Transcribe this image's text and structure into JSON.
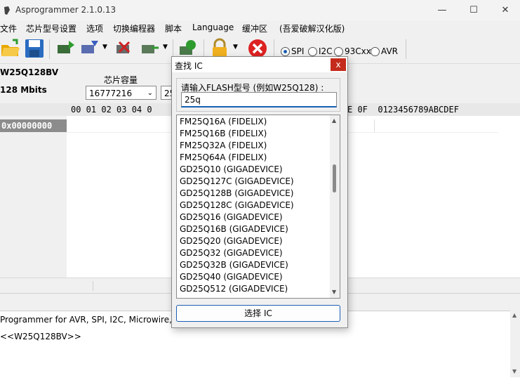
{
  "window": {
    "title": "Asprogrammer 2.1.0.13",
    "controls": [
      "—",
      "☐",
      "✕"
    ]
  },
  "menu": [
    "文件",
    "芯片型号设置",
    "选项",
    "切换编程器",
    "脚本",
    "Language",
    "缓冲区",
    "(吾爱破解汉化版)"
  ],
  "toolbar": {
    "icons": [
      "open-folder-icon",
      "save-icon",
      "read-chip-icon",
      "write-chip-icon",
      "erase-chip-icon",
      "verify-chip-icon",
      "blank-check-icon",
      "lock-icon",
      "stop-icon"
    ],
    "protocols": [
      {
        "label": "SPI",
        "selected": true
      },
      {
        "label": "I2C",
        "selected": false
      },
      {
        "label": "93Cxx",
        "selected": false
      },
      {
        "label": "AVR",
        "selected": false
      }
    ]
  },
  "info": {
    "chip_name": "W25Q128BV",
    "chip_size": "128 Mbits",
    "capacity_label": "芯片容量",
    "capacity_value": "16777216",
    "page_value": "25"
  },
  "hex": {
    "header": "00 01 02 03 04 0",
    "header_right": "E 0F  0123456789ABCDEF",
    "first_address": "0x00000000"
  },
  "log": {
    "lines": [
      "Programmer for AVR, SPI, I2C, Microwire,",
      "<<W25Q128BV>>"
    ]
  },
  "dialog": {
    "title": "查找 IC",
    "close": "x",
    "prompt": "请输入FLASH型号 (例如W25Q128) :",
    "search_value": "25q",
    "items": [
      "FM25Q16A (FIDELIX)",
      "FM25Q16B (FIDELIX)",
      "FM25Q32A (FIDELIX)",
      "FM25Q64A (FIDELIX)",
      "GD25Q10 (GIGADEVICE)",
      "GD25Q127C (GIGADEVICE)",
      "GD25Q128B (GIGADEVICE)",
      "GD25Q128C (GIGADEVICE)",
      "GD25Q16 (GIGADEVICE)",
      "GD25Q16B (GIGADEVICE)",
      "GD25Q20 (GIGADEVICE)",
      "GD25Q32 (GIGADEVICE)",
      "GD25Q32B (GIGADEVICE)",
      "GD25Q40 (GIGADEVICE)",
      "GD25Q512 (GIGADEVICE)"
    ],
    "select_button": "选择 IC"
  }
}
